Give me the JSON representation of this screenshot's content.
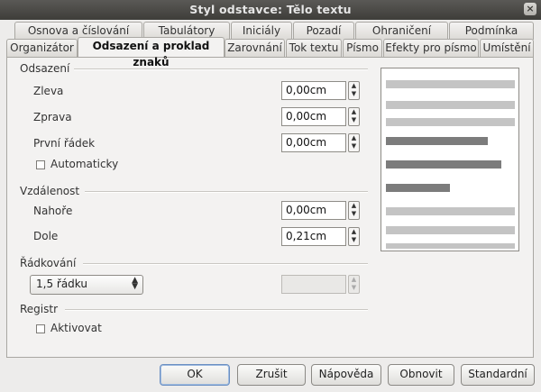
{
  "window": {
    "title": "Styl odstavce: Tělo textu",
    "close_glyph": "×"
  },
  "tabs_row1": [
    "Osnova a číslování",
    "Tabulátory",
    "Iniciály",
    "Pozadí",
    "Ohraničení",
    "Podmínka"
  ],
  "tabs_row2": [
    "Organizátor",
    "Odsazení a proklad znaků",
    "Zarovnání",
    "Tok textu",
    "Písmo",
    "Efekty pro písmo",
    "Umístění"
  ],
  "active_tab": "Odsazení a proklad znaků",
  "indent": {
    "title": "Odsazení",
    "left_label": "Zleva",
    "left_value": "0,00cm",
    "right_label": "Zprava",
    "right_value": "0,00cm",
    "first_line_label": "První řádek",
    "first_line_value": "0,00cm",
    "automatic_label": "Automaticky",
    "automatic_checked": false
  },
  "spacing": {
    "title": "Vzdálenost",
    "above_label": "Nahoře",
    "above_value": "0,00cm",
    "below_label": "Dole",
    "below_value": "0,21cm"
  },
  "line_spacing": {
    "title": "Řádkování",
    "selected": "1,5 řádku",
    "value": ""
  },
  "register": {
    "title": "Registr",
    "activate_label": "Aktivovat",
    "activate_checked": false
  },
  "buttons": {
    "ok": "OK",
    "cancel": "Zrušit",
    "help": "Nápověda",
    "reset": "Obnovit",
    "standard": "Standardní"
  },
  "colors": {
    "preview_text_line": "#c4c4c4",
    "preview_current_line": "#7c7c7c"
  }
}
